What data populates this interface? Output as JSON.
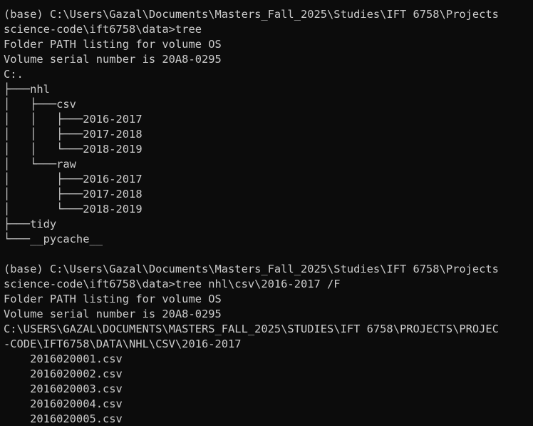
{
  "terminal": {
    "lines": [
      "(base) C:\\Users\\Gazal\\Documents\\Masters_Fall_2025\\Studies\\IFT 6758\\Projects",
      "science-code\\ift6758\\data>tree",
      "Folder PATH listing for volume OS",
      "Volume serial number is 20A8-0295",
      "C:.",
      "├───nhl",
      "│   ├───csv",
      "│   │   ├───2016-2017",
      "│   │   ├───2017-2018",
      "│   │   └───2018-2019",
      "│   └───raw",
      "│       ├───2016-2017",
      "│       ├───2017-2018",
      "│       └───2018-2019",
      "├───tidy",
      "└───__pycache__",
      "",
      "(base) C:\\Users\\Gazal\\Documents\\Masters_Fall_2025\\Studies\\IFT 6758\\Projects",
      "science-code\\ift6758\\data>tree nhl\\csv\\2016-2017 /F",
      "Folder PATH listing for volume OS",
      "Volume serial number is 20A8-0295",
      "C:\\USERS\\GAZAL\\DOCUMENTS\\MASTERS_FALL_2025\\STUDIES\\IFT 6758\\PROJECTS\\PROJEC",
      "-CODE\\IFT6758\\DATA\\NHL\\CSV\\2016-2017",
      "    2016020001.csv",
      "    2016020002.csv",
      "    2016020003.csv",
      "    2016020004.csv",
      "    2016020005.csv"
    ]
  }
}
